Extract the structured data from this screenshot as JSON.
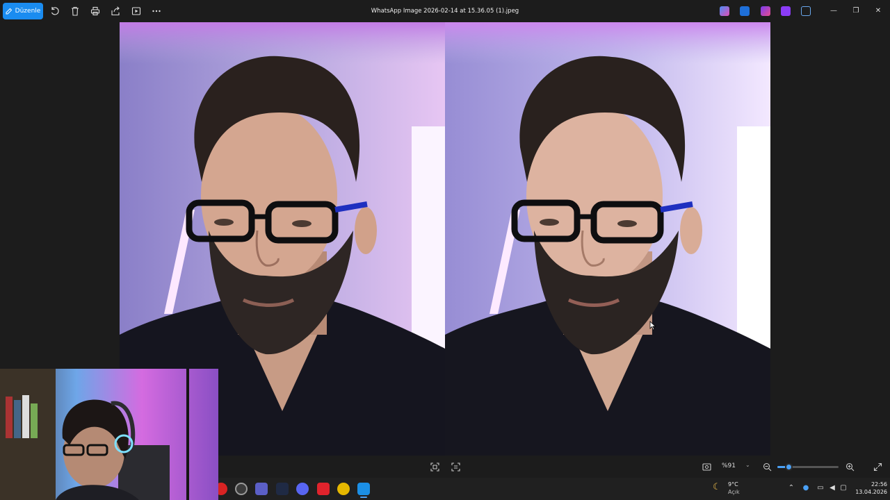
{
  "toolbar": {
    "edit_label": "Düzenle",
    "icons": [
      "rotate-icon",
      "delete-icon",
      "print-icon",
      "share-icon",
      "slideshow-icon",
      "more-icon"
    ]
  },
  "window": {
    "title": "WhatsApp Image 2026-02-14 at 15.36.05 (1).jpeg"
  },
  "bottom_bar": {
    "zoom_value": "%91",
    "zoom_fraction": 0.18
  },
  "weather": {
    "temp": "9°C",
    "desc": "Açık"
  },
  "clock": {
    "time": "22:56",
    "date": "13.04.2026"
  },
  "colors": {
    "accent": "#1a8cf0",
    "slider": "#4aa0f5"
  }
}
